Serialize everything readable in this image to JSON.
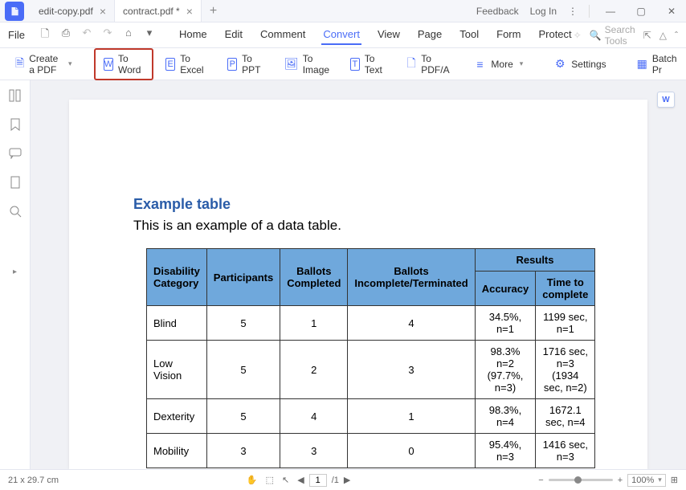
{
  "tabs": [
    {
      "label": "edit-copy.pdf",
      "active": false
    },
    {
      "label": "contract.pdf *",
      "active": true
    }
  ],
  "titlebar_right": {
    "feedback": "Feedback",
    "login": "Log In"
  },
  "file_menu": "File",
  "menu_tabs": [
    "Home",
    "Edit",
    "Comment",
    "Convert",
    "View",
    "Page",
    "Tool",
    "Form",
    "Protect"
  ],
  "menu_active": "Convert",
  "search_placeholder": "Search Tools",
  "toolbar": {
    "create_pdf": "Create a PDF",
    "to_word": "To Word",
    "to_excel": "To Excel",
    "to_ppt": "To PPT",
    "to_image": "To Image",
    "to_text": "To Text",
    "to_pdfa": "To PDF/A",
    "more": "More",
    "settings": "Settings",
    "batch": "Batch Pr"
  },
  "document": {
    "title": "Example table",
    "subtitle": "This is an example of a data table.",
    "headers": {
      "disability": "Disability Category",
      "participants": "Participants",
      "completed": "Ballots Completed",
      "incomplete": "Ballots Incomplete/Terminated",
      "results": "Results",
      "accuracy": "Accuracy",
      "time": "Time to complete"
    },
    "rows": [
      {
        "cat": "Blind",
        "part": "5",
        "comp": "1",
        "inc": "4",
        "acc": "34.5%, n=1",
        "time": "1199 sec, n=1"
      },
      {
        "cat": "Low Vision",
        "part": "5",
        "comp": "2",
        "inc": "3",
        "acc": "98.3% n=2\n(97.7%, n=3)",
        "time": "1716 sec, n=3\n(1934 sec, n=2)"
      },
      {
        "cat": "Dexterity",
        "part": "5",
        "comp": "4",
        "inc": "1",
        "acc": "98.3%, n=4",
        "time": "1672.1 sec, n=4"
      },
      {
        "cat": "Mobility",
        "part": "3",
        "comp": "3",
        "inc": "0",
        "acc": "95.4%, n=3",
        "time": "1416 sec, n=3"
      }
    ]
  },
  "statusbar": {
    "dimensions": "21 x 29.7 cm",
    "page_current": "1",
    "page_sep": "/1",
    "zoom": "100%"
  }
}
